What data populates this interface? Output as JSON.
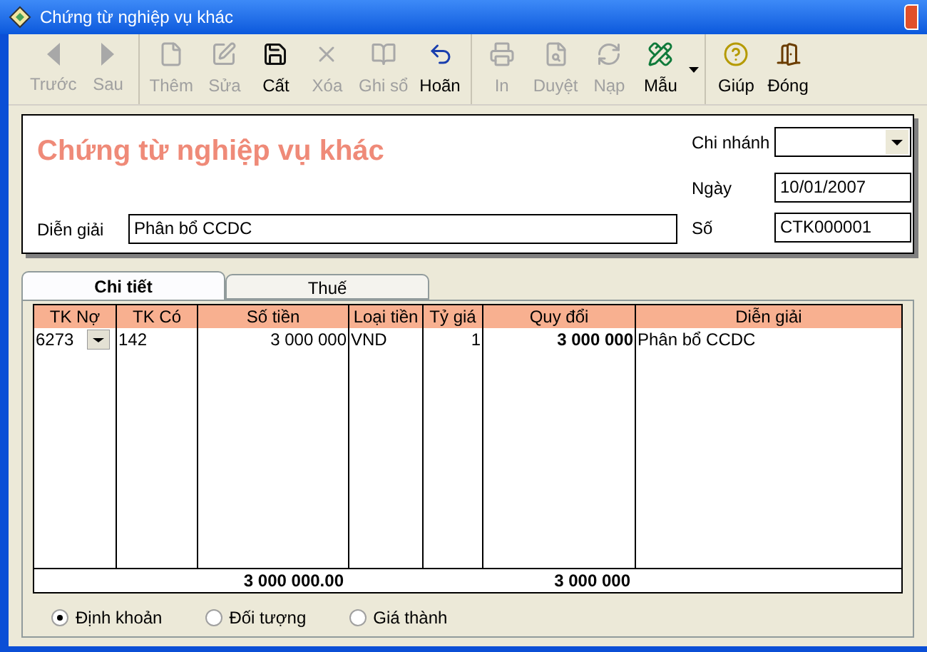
{
  "window": {
    "title": "Chứng từ nghiệp vụ khác"
  },
  "toolbar": {
    "groups": [
      [
        {
          "label": "Trước",
          "enabled": false
        },
        {
          "label": "Sau",
          "enabled": false
        }
      ],
      [
        {
          "label": "Thêm",
          "enabled": false
        },
        {
          "label": "Sửa",
          "enabled": false
        },
        {
          "label": "Cất",
          "enabled": true
        },
        {
          "label": "Xóa",
          "enabled": false
        },
        {
          "label": "Ghi sổ",
          "enabled": false
        },
        {
          "label": "Hoãn",
          "enabled": true
        }
      ],
      [
        {
          "label": "In",
          "enabled": false
        },
        {
          "label": "Duyệt",
          "enabled": false
        },
        {
          "label": "Nạp",
          "enabled": false
        },
        {
          "label": "Mẫu",
          "enabled": true,
          "has_menu": true
        }
      ],
      [
        {
          "label": "Giúp",
          "enabled": true
        },
        {
          "label": "Đóng",
          "enabled": true
        }
      ]
    ]
  },
  "header": {
    "title": "Chứng từ nghiệp vụ khác",
    "branch": {
      "label": "Chi nhánh"
    },
    "date": {
      "label": "Ngày",
      "value": "10/01/2007"
    },
    "description": {
      "label": "Diễn giải",
      "value": "Phân bổ CCDC"
    },
    "number": {
      "label": "Số",
      "value": "CTK000001"
    }
  },
  "tabs": [
    {
      "label": "Chi tiết",
      "selected": true
    },
    {
      "label": "Thuế",
      "selected": false
    }
  ],
  "table": {
    "columns": [
      {
        "label": "TK Nợ"
      },
      {
        "label": "TK Có"
      },
      {
        "label": "Số tiền"
      },
      {
        "label": "Loại tiền"
      },
      {
        "label": "Tỷ giá"
      },
      {
        "label": "Quy đổi"
      },
      {
        "label": "Diễn giải"
      }
    ],
    "rows": [
      [
        "6273",
        "142",
        "3 000 000",
        "VND",
        "1",
        "3 000 000",
        "Phân bổ CCDC"
      ]
    ],
    "totals": {
      "amount": "3 000 000.00",
      "converted": "3 000 000"
    }
  },
  "options": [
    {
      "label": "Định khoản",
      "selected": true
    },
    {
      "label": "Đối tượng",
      "selected": false
    },
    {
      "label": "Giá thành",
      "selected": false
    }
  ]
}
